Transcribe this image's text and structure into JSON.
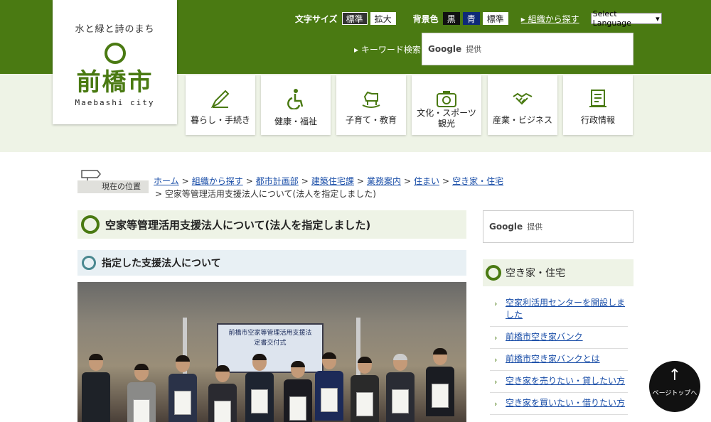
{
  "logo": {
    "tagline": "水と緑と詩のまち",
    "kanji": "前橋市",
    "roman": "Maebashi city"
  },
  "utility": {
    "font_size_label": "文字サイズ",
    "font_standard": "標準",
    "font_large": "拡大",
    "bg_label": "背景色",
    "bg_black": "黒",
    "bg_blue": "青",
    "bg_standard": "標準",
    "org_link": "組織から探す",
    "language_select": "Select Language"
  },
  "keyword": {
    "label": "キーワード検索",
    "google": "Google",
    "provided": "提供"
  },
  "nav": [
    {
      "label": "暮らし・手続き",
      "icon": "pen-icon"
    },
    {
      "label": "健康・福祉",
      "icon": "wheelchair-icon"
    },
    {
      "label": "子育て・教育",
      "icon": "rocking-horse-icon"
    },
    {
      "label": "文化・スポーツ観光",
      "line1": "文化・スポーツ",
      "line2": "観光",
      "icon": "camera-icon"
    },
    {
      "label": "産業・ビジネス",
      "icon": "handshake-icon"
    },
    {
      "label": "行政情報",
      "icon": "document-icon"
    }
  ],
  "breadcrumb": {
    "here_label": "現在の位置",
    "items": [
      "ホーム",
      "組織から探す",
      "都市計画部",
      "建築住宅課",
      "業務案内",
      "住まい",
      "空き家・住宅"
    ],
    "current": "空家等管理活用支援法人について(法人を指定しました)"
  },
  "main": {
    "title": "空家等管理活用支援法人について(法人を指定しました)",
    "subtitle": "指定した支援法人について",
    "photo_screen_line1": "前橋市空家等管理活用支援法",
    "photo_screen_line2": "定書交付式"
  },
  "sidebar": {
    "google": "Google",
    "provided": "提供",
    "heading": "空き家・住宅",
    "items": [
      "空家利活用センターを開設しました",
      "前橋市空き家バンク",
      "前橋市空き家バンクとは",
      "空き家を売りたい・貸したい方",
      "空き家を買いたい・借りたい方"
    ]
  },
  "page_top": {
    "arrow": "↑",
    "label": "ページトップへ"
  }
}
